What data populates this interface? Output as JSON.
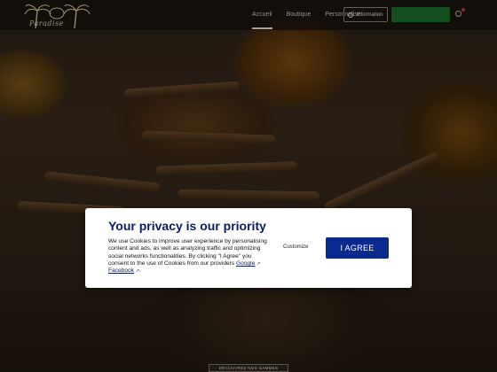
{
  "header": {
    "logo_text": "Paradise",
    "nav": [
      {
        "label": "Accueil",
        "active": true
      },
      {
        "label": "Boutique",
        "active": false
      },
      {
        "label": "Personnalisé",
        "active": false
      }
    ],
    "info_button": "Information",
    "green_button": ""
  },
  "cookie_modal": {
    "title": "Your privacy is our priority",
    "text_before": "We use Cookies to improve user experience by personalising content and ads, as well as analyzing traffic and optimizing social networks functionalities. By clicking \"I Agree\" you consent to the use of Cookies from our providers ",
    "link_google": "Google",
    "link_facebook": "Facebook",
    "text_end": ".",
    "customize_label": "Customize",
    "agree_label": "I AGREE"
  },
  "footer": {
    "bottom_box": "DÉCOUVREZ NOS GAMMES"
  },
  "colors": {
    "accent": "#0b2a8f",
    "title": "#0b1d66",
    "green": "#1c6f2b"
  }
}
